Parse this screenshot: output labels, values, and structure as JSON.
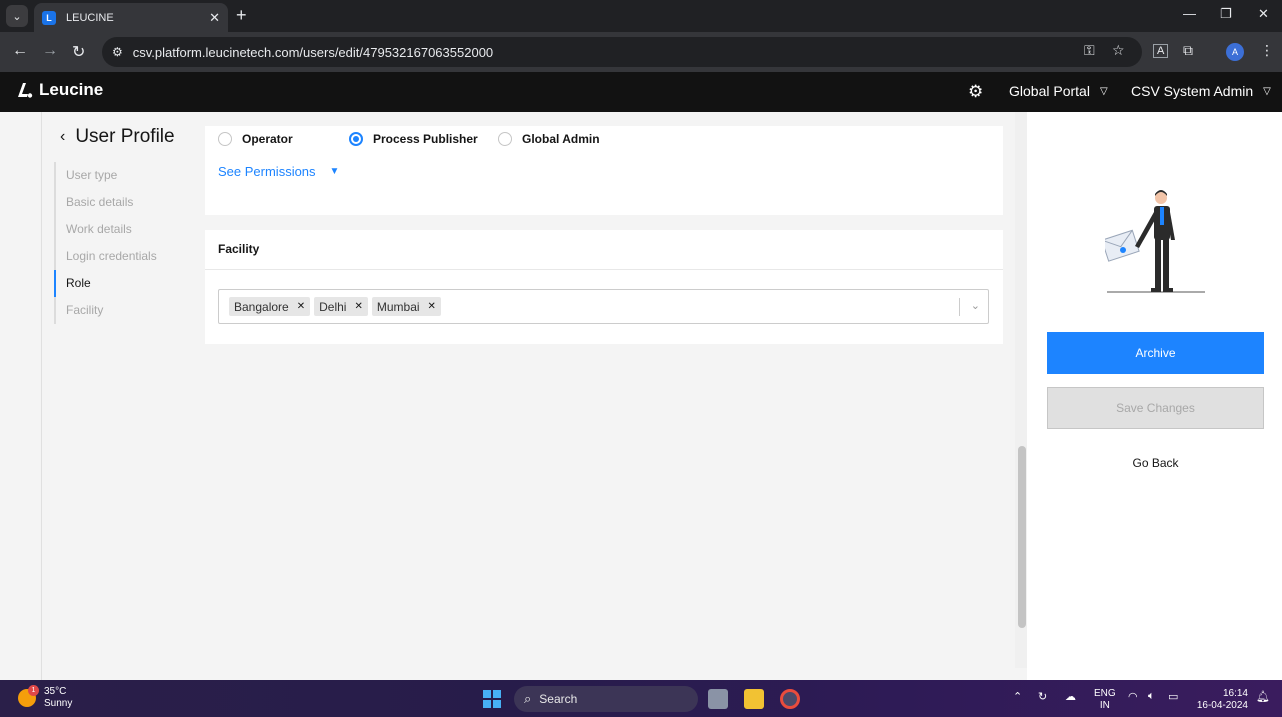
{
  "browser": {
    "tab_title": "LEUCINE",
    "url": "csv.platform.leucinetech.com/users/edit/479532167063552000",
    "profile_initial": "A"
  },
  "header": {
    "brand": "Leucine",
    "portal_label": "Global Portal",
    "user_label": "CSV System Admin"
  },
  "sidebar": {
    "title": "User Profile",
    "steps": [
      {
        "label": "User type"
      },
      {
        "label": "Basic details"
      },
      {
        "label": "Work details"
      },
      {
        "label": "Login credentials"
      },
      {
        "label": "Role"
      },
      {
        "label": "Facility"
      }
    ],
    "active_step": "Role"
  },
  "role": {
    "options": [
      {
        "label": "Operator",
        "checked": false
      },
      {
        "label": "Process Publisher",
        "checked": true
      },
      {
        "label": "Global Admin",
        "checked": false
      }
    ],
    "see_permissions": "See Permissions"
  },
  "facility": {
    "title": "Facility",
    "selected": [
      "Bangalore",
      "Delhi",
      "Mumbai"
    ]
  },
  "actions": {
    "archive": "Archive",
    "save_changes": "Save Changes",
    "go_back": "Go Back"
  },
  "taskbar": {
    "weather_temp": "35°C",
    "weather_desc": "Sunny",
    "weather_badge": "1",
    "search_label": "Search",
    "lang_top": "ENG",
    "lang_bottom": "IN",
    "time": "16:14",
    "date": "16-04-2024"
  },
  "colors": {
    "accent": "#1d84ff",
    "header_bg": "#121212",
    "page_bg": "#f4f4f4"
  }
}
